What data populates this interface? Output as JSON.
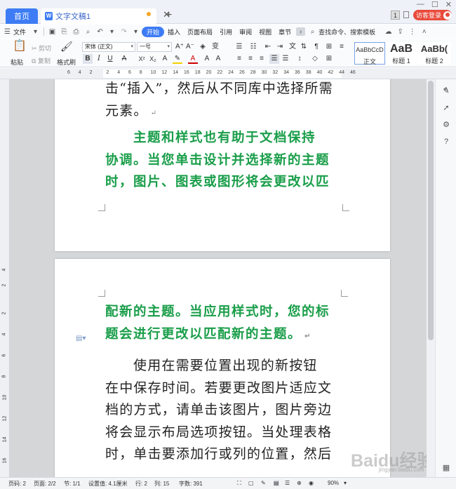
{
  "tabs": {
    "home": "首页",
    "doc": "文字文稿1",
    "badge": "1",
    "guest_login": "访客登录"
  },
  "menu": {
    "file": "文件",
    "items": [
      "开始",
      "插入",
      "页面布局",
      "引用",
      "审阅",
      "视图",
      "章节"
    ],
    "search": "查找命令、搜索模板"
  },
  "ribbon": {
    "paste": "粘贴",
    "cut": "剪切",
    "copy": "复制",
    "format_painter": "格式刷",
    "font_name": "宋体 (正文)",
    "font_size": "一号",
    "styles": [
      {
        "sample": "AaBbCcD",
        "label": "正文"
      },
      {
        "sample": "AaB",
        "label": "标题 1"
      },
      {
        "sample": "AaBb(",
        "label": "标题 2"
      }
    ]
  },
  "ruler": {
    "numbers": [
      "6",
      "4",
      "2",
      "2",
      "4",
      "6",
      "8",
      "10",
      "12",
      "14",
      "16",
      "18",
      "20",
      "22",
      "24",
      "26",
      "28",
      "30",
      "32",
      "34",
      "36",
      "38",
      "40",
      "42",
      "44",
      "46"
    ]
  },
  "page1": {
    "line1": "击“插入”，然后从不同库中选择所需",
    "line2": "元素。",
    "green_lines": [
      "主题和样式也有助于文档保持",
      "协调。当您单击设计并选择新的主题",
      "时，图片、图表或图形将会更改以匹"
    ]
  },
  "page2": {
    "green_lines": [
      "配新的主题。当应用样式时，您的标",
      "题会进行更改以匹配新的主题。"
    ],
    "black_lines": [
      "使用在需要位置出现的新按钮",
      "在中保存时间。若要更改图片适应文",
      "档的方式，请单击该图片，图片旁边",
      "将会显示布局选项按钮。当处理表格",
      "时，单击要添加行或列的位置，然后"
    ]
  },
  "status": {
    "page_code": "页码: 2",
    "pages": "页面: 2/2",
    "section": "节: 1/1",
    "setting": "设置值: 4.1厘米",
    "row": "行: 2",
    "col": "列: 15",
    "words": "字数: 391",
    "zoom": "90%"
  },
  "watermark": "Baidu经验",
  "watermark_sub": "jingyan.baidu.com"
}
